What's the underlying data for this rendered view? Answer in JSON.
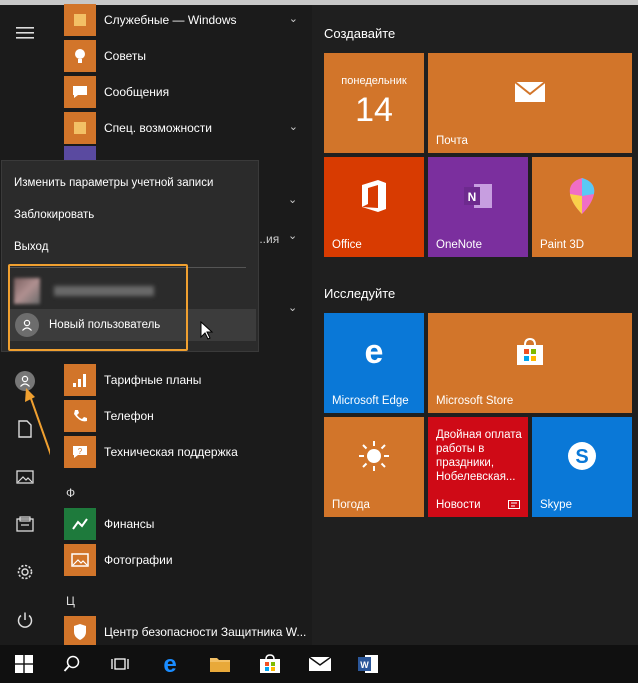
{
  "start_menu": {
    "app_list": [
      {
        "label": "Служебные — Windows",
        "icon": "folder-icon",
        "expandable": true
      },
      {
        "label": "Советы",
        "icon": "lightbulb-icon",
        "expandable": false
      },
      {
        "label": "Сообщения",
        "icon": "chat-icon",
        "expandable": false
      },
      {
        "label": "Спец. возможности",
        "icon": "folder-icon",
        "expandable": true
      },
      {
        "label": "Тарифные планы",
        "icon": "signal-bars-icon",
        "expandable": false
      },
      {
        "label": "Телефон",
        "icon": "phone-icon",
        "expandable": false
      },
      {
        "label": "Техническая поддержка",
        "icon": "help-icon",
        "expandable": false
      },
      {
        "label": "Финансы",
        "icon": "chart-icon",
        "expandable": false
      },
      {
        "label": "Фотографии",
        "icon": "photo-icon",
        "expandable": false
      },
      {
        "label": "Центр безопасности Защитника W...",
        "icon": "shield-icon",
        "expandable": false
      }
    ],
    "letters": {
      "f": "Ф",
      "ts": "Ц"
    },
    "partial_label": "...ия",
    "account_popup": {
      "change_settings": "Изменить параметры учетной записи",
      "lock": "Заблокировать",
      "sign_out": "Выход",
      "new_user": "Новый пользователь"
    },
    "groups": {
      "create": "Создавайте",
      "explore": "Исследуйте"
    },
    "tiles": {
      "calendar_day": "понедельник",
      "calendar_date": "14",
      "mail": "Почта",
      "office": "Office",
      "onenote": "OneNote",
      "paint3d": "Paint 3D",
      "edge": "Microsoft Edge",
      "store": "Microsoft Store",
      "news_headline": "Двойная оплата работы в праздники, Нобелевская...",
      "news": "Новости",
      "weather": "Погода",
      "skype": "Skype"
    }
  },
  "colors": {
    "tile_orange": "#d2752a",
    "tile_red": "#d83b01",
    "tile_purple": "#7b2f9e",
    "tile_blue": "#0a78d7",
    "news_red": "#cf0a16",
    "highlight_orange": "#f0a030"
  }
}
